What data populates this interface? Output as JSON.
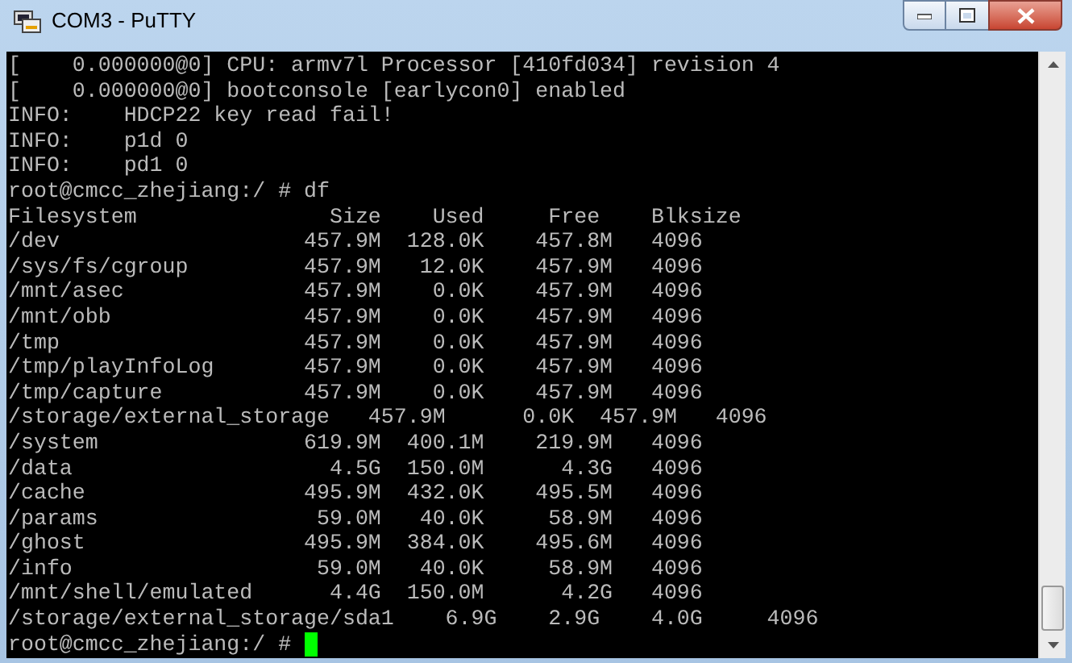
{
  "window": {
    "title": "COM3 - PuTTY"
  },
  "terminal": {
    "lines": [
      "[    0.000000@0] CPU: armv7l Processor [410fd034] revision 4",
      "[    0.000000@0] bootconsole [earlycon0] enabled",
      "INFO:    HDCP22 key read fail!",
      "INFO:    p1d 0",
      "INFO:    pd1 0",
      "root@cmcc_zhejiang:/ # df",
      "Filesystem               Size    Used     Free    Blksize",
      "/dev                   457.9M  128.0K    457.8M   4096",
      "/sys/fs/cgroup         457.9M   12.0K    457.9M   4096",
      "/mnt/asec              457.9M    0.0K    457.9M   4096",
      "/mnt/obb               457.9M    0.0K    457.9M   4096",
      "/tmp                   457.9M    0.0K    457.9M   4096",
      "/tmp/playInfoLog       457.9M    0.0K    457.9M   4096",
      "/tmp/capture           457.9M    0.0K    457.9M   4096",
      "/storage/external_storage   457.9M      0.0K  457.9M   4096",
      "/system                619.9M  400.1M    219.9M   4096",
      "/data                    4.5G  150.0M      4.3G   4096",
      "/cache                 495.9M  432.0K    495.5M   4096",
      "/params                 59.0M   40.0K     58.9M   4096",
      "/ghost                 495.9M  384.0K    495.6M   4096",
      "/info                   59.0M   40.0K     58.9M   4096",
      "/mnt/shell/emulated      4.4G  150.0M      4.2G   4096",
      "/storage/external_storage/sda1    6.9G    2.9G    4.0G     4096"
    ],
    "prompt": {
      "text": "root@cmcc_zhejiang:/ #",
      "cursor": true
    }
  }
}
